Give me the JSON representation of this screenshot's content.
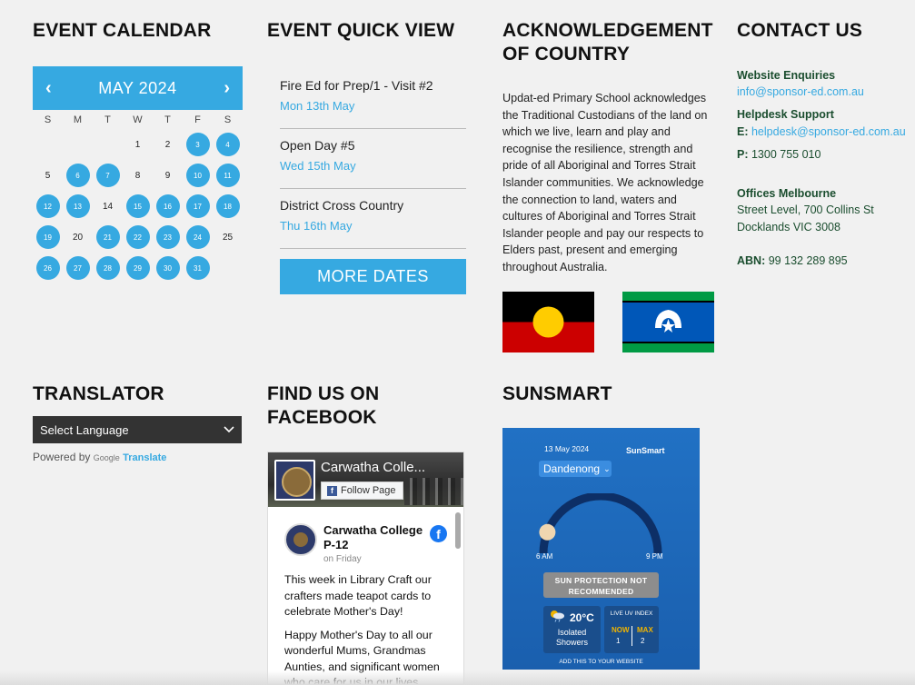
{
  "headings": {
    "calendar": "EVENT CALENDAR",
    "quickview": "EVENT QUICK VIEW",
    "ack": "ACKNOWLEDGEMENT OF COUNTRY",
    "contact": "CONTACT US",
    "translator": "TRANSLATOR",
    "facebook": "FIND US ON FACEBOOK",
    "sunsmart": "SUNSMART"
  },
  "calendar": {
    "prev": "‹",
    "next": "›",
    "month": "MAY 2024",
    "dow": [
      "S",
      "M",
      "T",
      "W",
      "T",
      "F",
      "S"
    ],
    "lead_blanks": 3,
    "days": 31,
    "event_days": [
      3,
      4,
      6,
      7,
      10,
      11,
      12,
      13,
      15,
      16,
      17,
      18,
      19,
      21,
      22,
      23,
      24,
      26,
      27,
      28,
      29,
      30,
      31
    ]
  },
  "events": [
    {
      "title": "Fire Ed for Prep/1 - Visit #2",
      "date": "Mon 13th May"
    },
    {
      "title": "Open Day #5",
      "date": "Wed 15th May"
    },
    {
      "title": "District Cross Country",
      "date": "Thu 16th May"
    }
  ],
  "more_dates": "MORE DATES",
  "ack_text": "Updat-ed Primary School acknowledges the Traditional Custodians of the land on which we live, learn and play and recognise the resilience, strength and pride of all Aboriginal and Torres Strait Islander communities. We acknowledge the connection to land, waters and cultures of Aboriginal and Torres Strait Islander people and pay our respects to Elders past, present and emerging throughout Australia.",
  "colors": {
    "accent": "#36a9e1",
    "contact_green": "#1a4d2e",
    "aboriginal_black": "#000000",
    "aboriginal_red": "#cc0000",
    "aboriginal_yellow": "#ffcc00",
    "tsi_green": "#009a44",
    "tsi_blue": "#0057b8"
  },
  "contact": {
    "web_label": "Website Enquiries",
    "web_email": "info@sponsor-ed.com.au",
    "help_label": "Helpdesk Support",
    "e_prefix": "E:",
    "help_email": "helpdesk@sponsor-ed.com.au",
    "p_prefix": "P:",
    "phone": "1300 755 010",
    "office_label": "Offices Melbourne",
    "addr1": "Street Level, 700 Collins St",
    "addr2": "Docklands VIC 3008",
    "abn_label": "ABN:",
    "abn": "99 132 289 895"
  },
  "translator": {
    "select_label": "Select Language",
    "powered": "Powered by",
    "google": "Google",
    "translate": "Translate"
  },
  "facebook": {
    "page_name": "Carwatha Colle...",
    "follow": "Follow Page",
    "poster": "Carwatha College P-12",
    "when": "on Friday",
    "p1": "This week in Library Craft our crafters made teapot cards to celebrate Mother's Day!",
    "p2": "Happy Mother's Day to all our wonderful Mums, Grandmas Aunties, and significant women who care for us in our lives."
  },
  "sunsmart": {
    "date": "13 May 2024",
    "brand": "SunSmart",
    "location": "Dandenong",
    "start": "6 AM",
    "end": "9 PM",
    "warning": "SUN PROTECTION NOT RECOMMENDED",
    "temp": "20°C",
    "condition": "Isolated Showers",
    "uv_title": "LIVE UV INDEX",
    "now_label": "NOW",
    "max_label": "MAX",
    "uv_now": "1",
    "uv_max": "2",
    "add": "ADD THIS TO YOUR WEBSITE",
    "day_progress": 0.12
  }
}
